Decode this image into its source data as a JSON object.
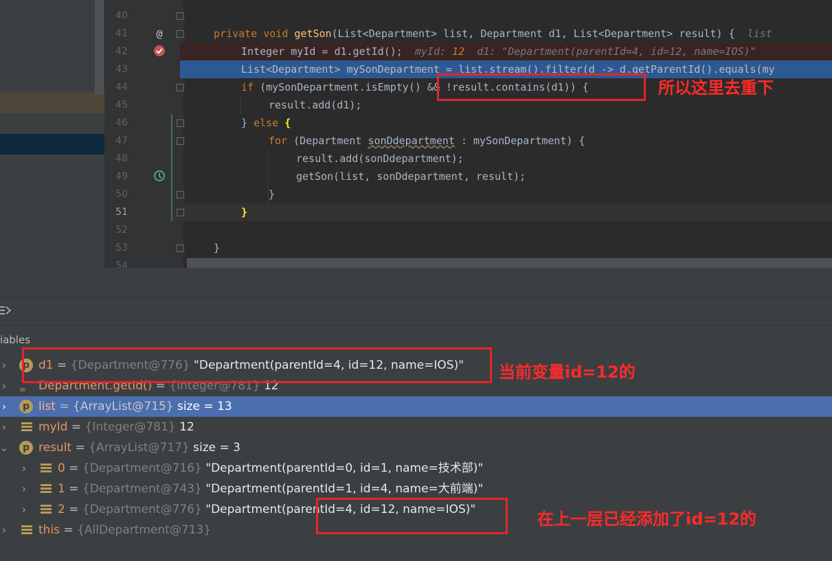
{
  "editor": {
    "line_numbers": [
      "40",
      "41",
      "42",
      "43",
      "44",
      "45",
      "46",
      "47",
      "48",
      "49",
      "50",
      "51",
      "52",
      "53",
      "54"
    ],
    "current_line": "51",
    "code": {
      "l41": {
        "private": "private",
        "void": "void",
        "fn": "getSon",
        "sig": "(List<Department> list, Department d1, List<Department> result) {",
        "hint": "list"
      },
      "l42": {
        "text": "Integer myId = d1.getId();",
        "hint1": "myId: ",
        "hint_val": "12",
        "hint2": "d1: \"Department(parentId=4, id=12, name=IOS)\""
      },
      "l43": {
        "text": "List<Department> mySonDepartment = list.stream().filter(d -> d.getParentId().equals(my"
      },
      "l44": {
        "if": "if",
        "text": " (mySonDepartment.isEmpty() && !result.contains(d1)) {"
      },
      "l45": {
        "text": "result.add(d1);"
      },
      "l46": {
        "close": "} ",
        "else": "else",
        "brace": "{"
      },
      "l47": {
        "for": "for",
        "p1": " (Department ",
        "var": "sonDdepartment",
        "p2": " : mySonDepartment) {"
      },
      "l48": {
        "text": "result.add(sonDdepartment);"
      },
      "l49": {
        "text": "getSon(list, sonDdepartment, result);"
      },
      "l50": {
        "text": "}"
      },
      "l51": {
        "text": "}"
      },
      "l53": {
        "text": "}"
      }
    },
    "gutter_icons": {
      "at": "@"
    }
  },
  "debugger": {
    "panel_label": "iables",
    "variables": [
      {
        "name": "d1",
        "ref": "{Department@776}",
        "value": "\"Department(parentId=4, id=12, name=IOS)\"",
        "badge": "p"
      },
      {
        "name": "Department.getId()",
        "ref": "{Integer@781}",
        "value": "12",
        "badge": "oo"
      },
      {
        "name": "list",
        "ref": "{ArrayList@715}",
        "value": "size = 13",
        "badge": "p"
      },
      {
        "name": "myId",
        "ref": "{Integer@781}",
        "value": "12",
        "badge": "bars"
      },
      {
        "name": "result",
        "ref": "{ArrayList@717}",
        "value": "size = 3",
        "badge": "p"
      },
      {
        "name": "0",
        "ref": "{Department@716}",
        "value": "\"Department(parentId=0, id=1, name=技术部)\"",
        "badge": "bars"
      },
      {
        "name": "1",
        "ref": "{Department@743}",
        "value": "\"Department(parentId=1, id=4, name=大前端)\"",
        "badge": "bars"
      },
      {
        "name": "2",
        "ref": "{Department@776}",
        "value": "\"Department(parentId=4, id=12, name=IOS)\"",
        "badge": "bars"
      },
      {
        "name": "this",
        "ref": "{AllDepartment@713}",
        "value": "",
        "badge": "bars"
      }
    ]
  },
  "annotations": {
    "dedup_note": "所以这里去重下",
    "current_var_note": "当前变量id=12的",
    "already_added_note": "在上一层已经添加了id=12的"
  },
  "colors": {
    "annotation_red": "#e8232b",
    "selection_blue": "#4b6eaf",
    "editor_bg": "#2b2b2b"
  }
}
